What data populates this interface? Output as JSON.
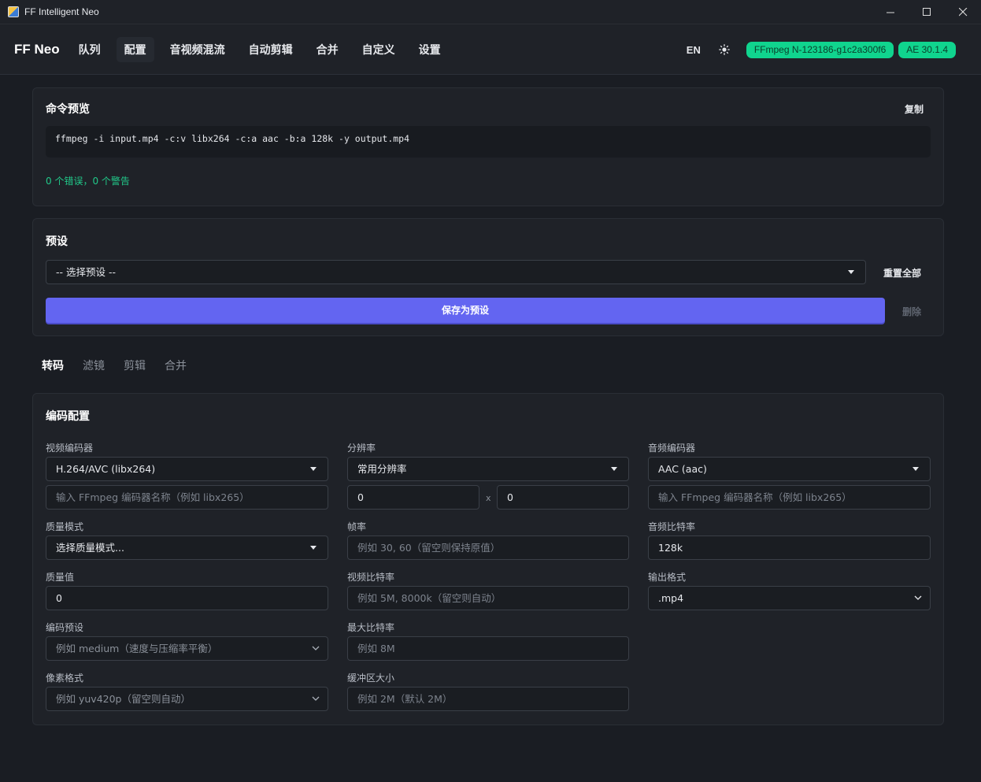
{
  "window": {
    "title": "FF Intelligent Neo"
  },
  "nav": {
    "brand": "FF Neo",
    "items": [
      "队列",
      "配置",
      "音视频混流",
      "自动剪辑",
      "合并",
      "自定义",
      "设置"
    ],
    "active": "配置",
    "lang": "EN",
    "badges": [
      "FFmpeg N-123186-g1c2a300f6",
      "AE 30.1.4"
    ],
    "badge_color": "#10d48e",
    "accent": "#6365f1"
  },
  "command_preview": {
    "title": "命令预览",
    "copy_label": "复制",
    "command": "ffmpeg -i input.mp4 -c:v libx264 -c:a aac -b:a 128k -y output.mp4",
    "status": "0 个错误，0 个警告",
    "status_color": "#21c98a"
  },
  "preset": {
    "title": "预设",
    "select_value": "-- 选择预设 --",
    "reset_label": "重置全部",
    "save_label": "保存为预设",
    "delete_label": "删除"
  },
  "tabs": [
    "转码",
    "滤镜",
    "剪辑",
    "合并"
  ],
  "encode": {
    "title": "编码配置",
    "video_encoder": {
      "label": "视频编码器",
      "value": "H.264/AVC (libx264)",
      "custom_placeholder": "输入 FFmpeg 编码器名称（例如 libx265）"
    },
    "quality_mode": {
      "label": "质量模式",
      "value": "选择质量模式..."
    },
    "quality_value": {
      "label": "质量值",
      "value": "0"
    },
    "encode_preset": {
      "label": "编码预设",
      "placeholder": "例如 medium（速度与压缩率平衡）"
    },
    "pixel_format": {
      "label": "像素格式",
      "placeholder": "例如 yuv420p（留空则自动）"
    },
    "resolution": {
      "label": "分辨率",
      "value": "常用分辨率",
      "width": "0",
      "height": "0",
      "sep": "x"
    },
    "framerate": {
      "label": "帧率",
      "placeholder": "例如 30, 60（留空则保持原值）"
    },
    "video_bitrate": {
      "label": "视频比特率",
      "placeholder": "例如 5M, 8000k（留空则自动）"
    },
    "max_bitrate": {
      "label": "最大比特率",
      "placeholder": "例如 8M"
    },
    "buffer_size": {
      "label": "缓冲区大小",
      "placeholder": "例如 2M（默认 2M）"
    },
    "audio_encoder": {
      "label": "音频编码器",
      "value": "AAC (aac)",
      "custom_placeholder": "输入 FFmpeg 编码器名称（例如 libx265）"
    },
    "audio_bitrate": {
      "label": "音频比特率",
      "value": "128k"
    },
    "output_format": {
      "label": "输出格式",
      "value": ".mp4"
    }
  }
}
